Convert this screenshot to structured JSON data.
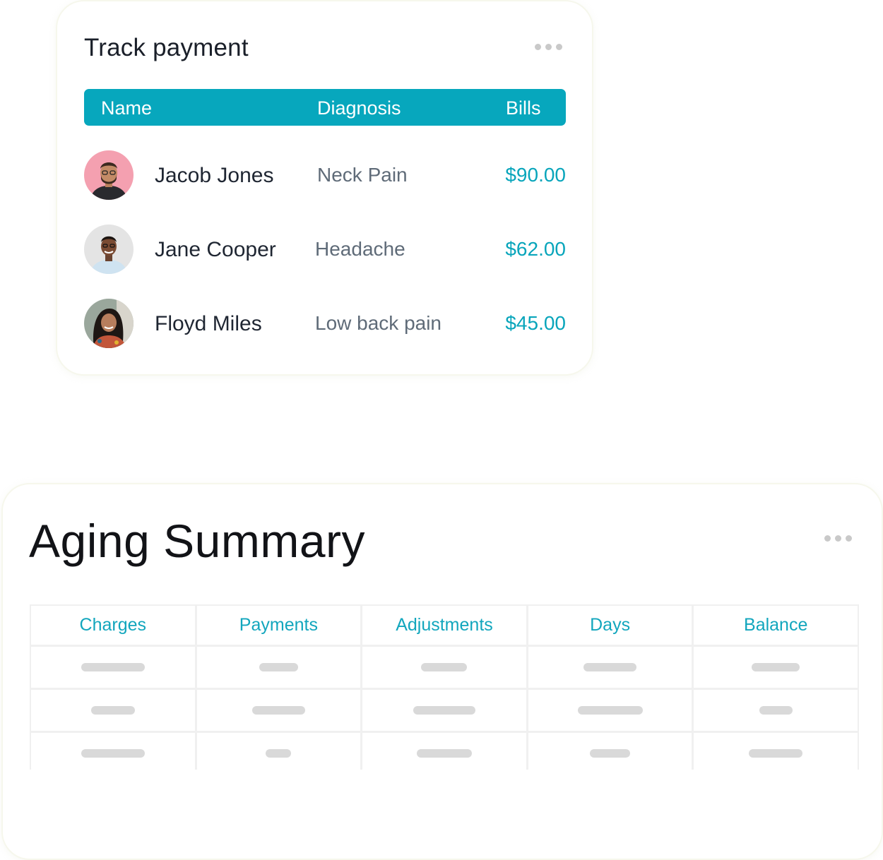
{
  "track_payment": {
    "title": "Track payment",
    "header": {
      "name": "Name",
      "diagnosis": "Diagnosis",
      "bills": "Bills"
    },
    "rows": [
      {
        "name": "Jacob Jones",
        "diagnosis": "Neck Pain",
        "bill": "$90.00"
      },
      {
        "name": "Jane Cooper",
        "diagnosis": "Headache",
        "bill": "$62.00"
      },
      {
        "name": "Floyd Miles",
        "diagnosis": "Low back pain",
        "bill": "$45.00"
      }
    ]
  },
  "aging_summary": {
    "title": "Aging Summary",
    "columns": [
      "Charges",
      "Payments",
      "Adjustments",
      "Days",
      "Balance"
    ]
  },
  "colors": {
    "accent": "#07a7bd",
    "placeholder": "#d9d9d9"
  }
}
